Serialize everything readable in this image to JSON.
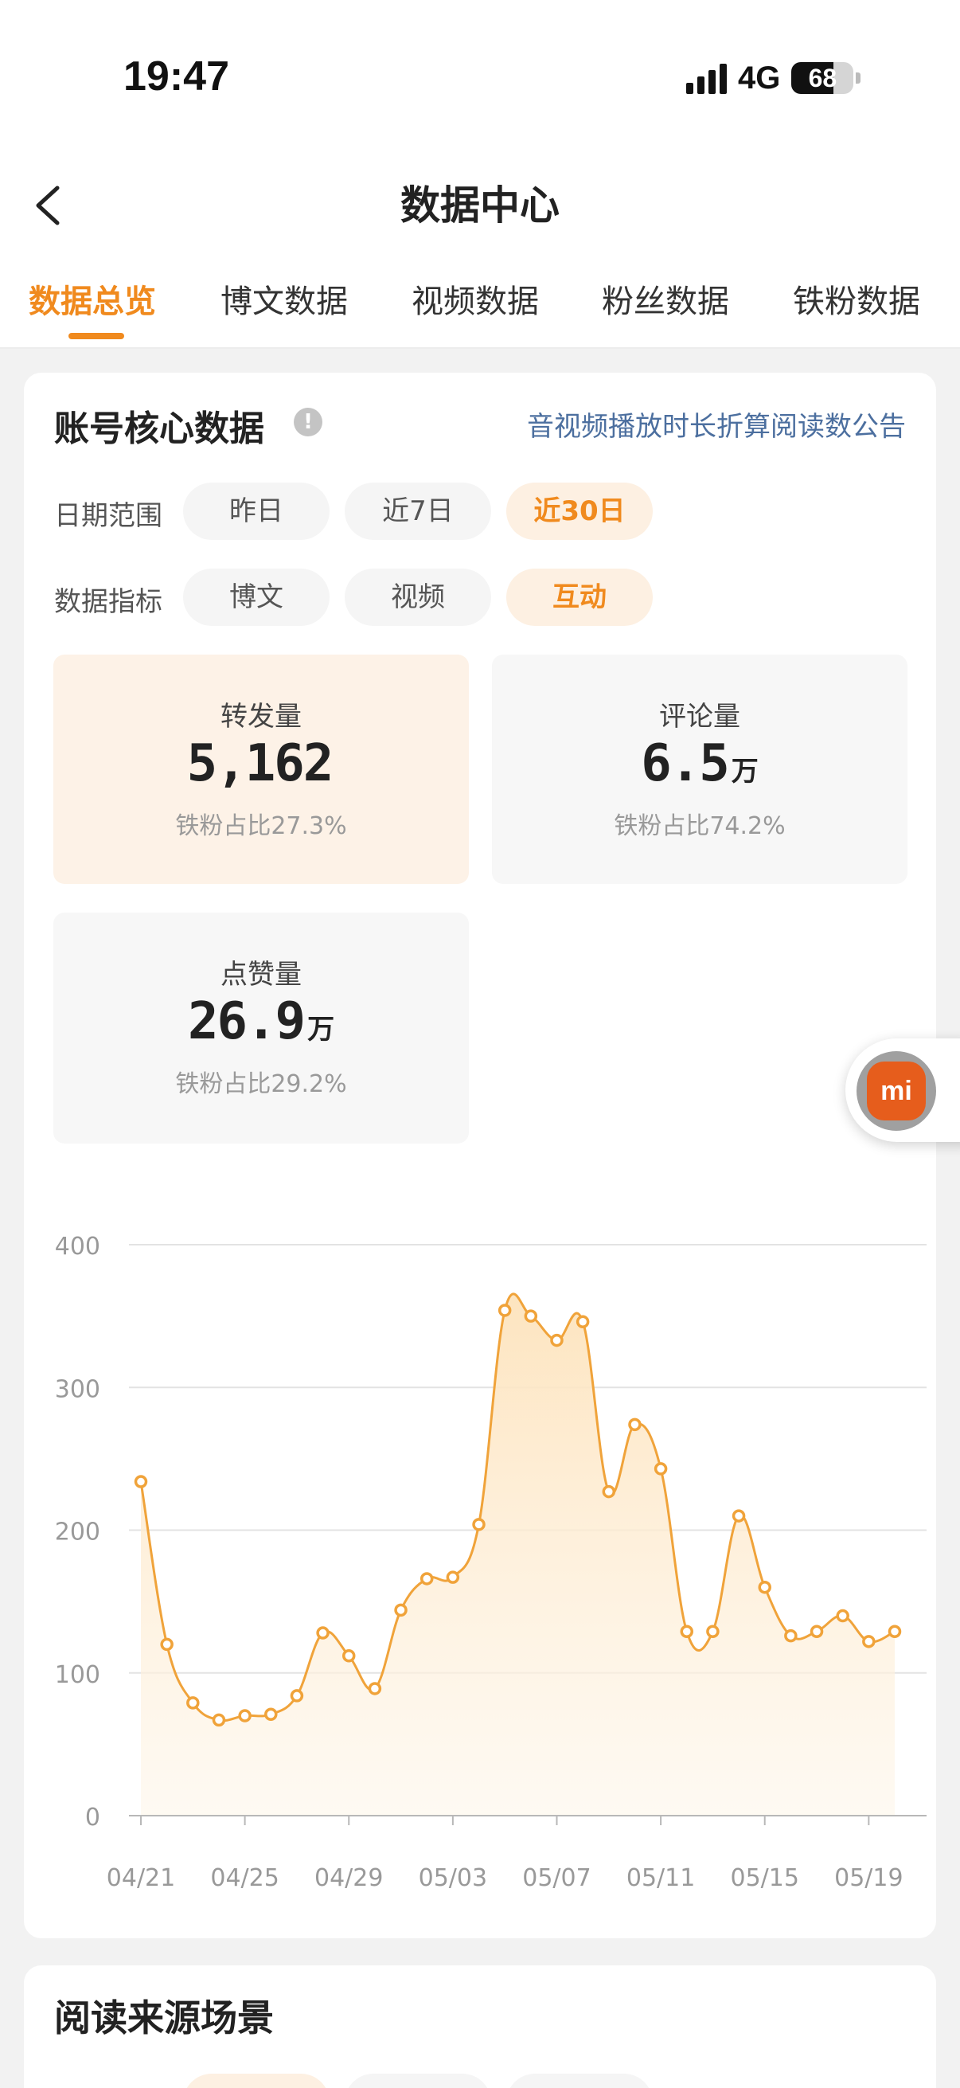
{
  "status": {
    "time": "19:47",
    "network": "4G",
    "battery": "68",
    "battery_level": 0.68
  },
  "nav": {
    "title": "数据中心"
  },
  "tabs": [
    {
      "label": "数据总览",
      "active": true
    },
    {
      "label": "博文数据",
      "active": false
    },
    {
      "label": "视频数据",
      "active": false
    },
    {
      "label": "粉丝数据",
      "active": false
    },
    {
      "label": "铁粉数据",
      "active": false
    }
  ],
  "core": {
    "title": "账号核心数据",
    "info_icon": "!",
    "notice": "音视频播放时长折算阅读数公告",
    "date_range": {
      "label": "日期范围",
      "options": [
        "昨日",
        "近7日",
        "近30日"
      ],
      "selected": "近30日"
    },
    "metric_type": {
      "label": "数据指标",
      "options": [
        "博文",
        "视频",
        "互动"
      ],
      "selected": "互动"
    },
    "metrics": [
      {
        "label": "转发量",
        "value": "5,162",
        "unit": "",
        "sub": "铁粉占比27.3%",
        "active": true
      },
      {
        "label": "评论量",
        "value": "6.5",
        "unit": "万",
        "sub": "铁粉占比74.2%",
        "active": false
      },
      {
        "label": "点赞量",
        "value": "26.9",
        "unit": "万",
        "sub": "铁粉占比29.2%",
        "active": false
      }
    ]
  },
  "chart_data": {
    "type": "area",
    "x": [
      "04/21",
      "04/22",
      "04/23",
      "04/24",
      "04/25",
      "04/26",
      "04/27",
      "04/28",
      "04/29",
      "04/30",
      "05/01",
      "05/02",
      "05/03",
      "05/04",
      "05/05",
      "05/06",
      "05/07",
      "05/08",
      "05/09",
      "05/10",
      "05/11",
      "05/12",
      "05/13",
      "05/14",
      "05/15",
      "05/16",
      "05/17",
      "05/18",
      "05/19",
      "05/20"
    ],
    "x_tick_labels": [
      "04/21",
      "04/25",
      "04/29",
      "05/03",
      "05/07",
      "05/11",
      "05/15",
      "05/19"
    ],
    "series": [
      {
        "values": [
          234,
          120,
          79,
          67,
          70,
          71,
          84,
          128,
          112,
          89,
          144,
          166,
          167,
          204,
          354,
          350,
          333,
          346,
          227,
          274,
          243,
          129,
          129,
          210,
          160,
          126,
          129,
          140,
          122,
          129
        ]
      }
    ],
    "ylim": [
      0,
      400
    ],
    "yticks": [
      0,
      100,
      200,
      300,
      400
    ],
    "grid": true,
    "line_color": "#f0a33a",
    "fill_color": "#fde3bc"
  },
  "source": {
    "title": "阅读来源场景"
  },
  "float_button": {
    "logo": "mi"
  }
}
